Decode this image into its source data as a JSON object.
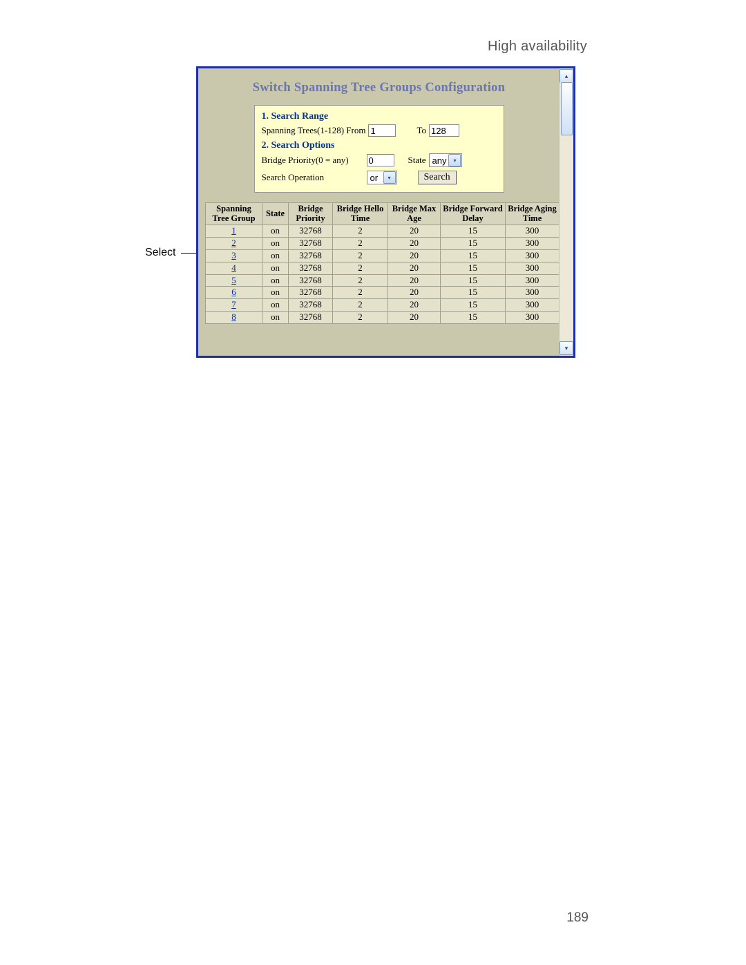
{
  "page": {
    "header_label": "High availability",
    "number": "189",
    "select_callout": "Select"
  },
  "ui": {
    "title": "Switch Spanning Tree Groups Configuration",
    "search": {
      "range_head": "1. Search Range",
      "range_label": "Spanning Trees(1-128) From",
      "range_from_value": "1",
      "range_to_label": "To",
      "range_to_value": "128",
      "options_head": "2. Search Options",
      "priority_label": "Bridge Priority(0 = any)",
      "priority_value": "0",
      "state_label": "State",
      "state_select_value": "any",
      "operation_label": "Search Operation",
      "operation_select_value": "or",
      "search_button": "Search"
    },
    "table": {
      "headers": {
        "group": "Spanning Tree Group",
        "state": "State",
        "priority": "Bridge Priority",
        "hello": "Bridge Hello Time",
        "max_age": "Bridge Max Age",
        "fwd_delay": "Bridge Forward Delay",
        "aging": "Bridge Aging Time"
      },
      "rows": [
        {
          "group": "1",
          "state": "on",
          "priority": "32768",
          "hello": "2",
          "max_age": "20",
          "fwd_delay": "15",
          "aging": "300"
        },
        {
          "group": "2",
          "state": "on",
          "priority": "32768",
          "hello": "2",
          "max_age": "20",
          "fwd_delay": "15",
          "aging": "300"
        },
        {
          "group": "3",
          "state": "on",
          "priority": "32768",
          "hello": "2",
          "max_age": "20",
          "fwd_delay": "15",
          "aging": "300"
        },
        {
          "group": "4",
          "state": "on",
          "priority": "32768",
          "hello": "2",
          "max_age": "20",
          "fwd_delay": "15",
          "aging": "300"
        },
        {
          "group": "5",
          "state": "on",
          "priority": "32768",
          "hello": "2",
          "max_age": "20",
          "fwd_delay": "15",
          "aging": "300"
        },
        {
          "group": "6",
          "state": "on",
          "priority": "32768",
          "hello": "2",
          "max_age": "20",
          "fwd_delay": "15",
          "aging": "300"
        },
        {
          "group": "7",
          "state": "on",
          "priority": "32768",
          "hello": "2",
          "max_age": "20",
          "fwd_delay": "15",
          "aging": "300"
        },
        {
          "group": "8",
          "state": "on",
          "priority": "32768",
          "hello": "2",
          "max_age": "20",
          "fwd_delay": "15",
          "aging": "300"
        }
      ]
    }
  }
}
